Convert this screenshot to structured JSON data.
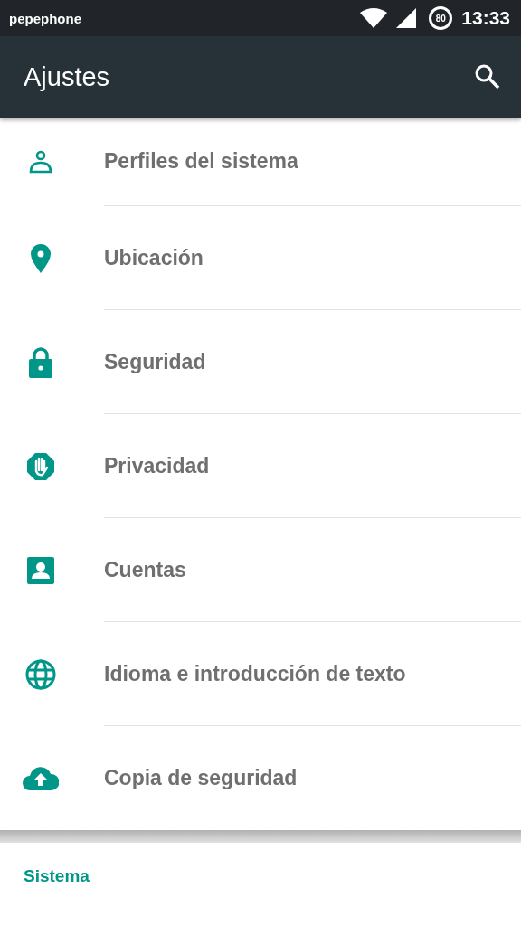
{
  "status_bar": {
    "carrier": "pepephone",
    "battery": "80",
    "time": "13:33"
  },
  "app_bar": {
    "title": "Ajustes"
  },
  "items": [
    {
      "kind": "person",
      "label": "Perfiles del sistema"
    },
    {
      "kind": "pin",
      "label": "Ubicación"
    },
    {
      "kind": "lock",
      "label": "Seguridad"
    },
    {
      "kind": "hand",
      "label": "Privacidad"
    },
    {
      "kind": "account",
      "label": "Cuentas"
    },
    {
      "kind": "globe",
      "label": "Idioma e introducción de texto"
    },
    {
      "kind": "cloud",
      "label": "Copia de seguridad"
    }
  ],
  "section": {
    "title": "Sistema"
  }
}
